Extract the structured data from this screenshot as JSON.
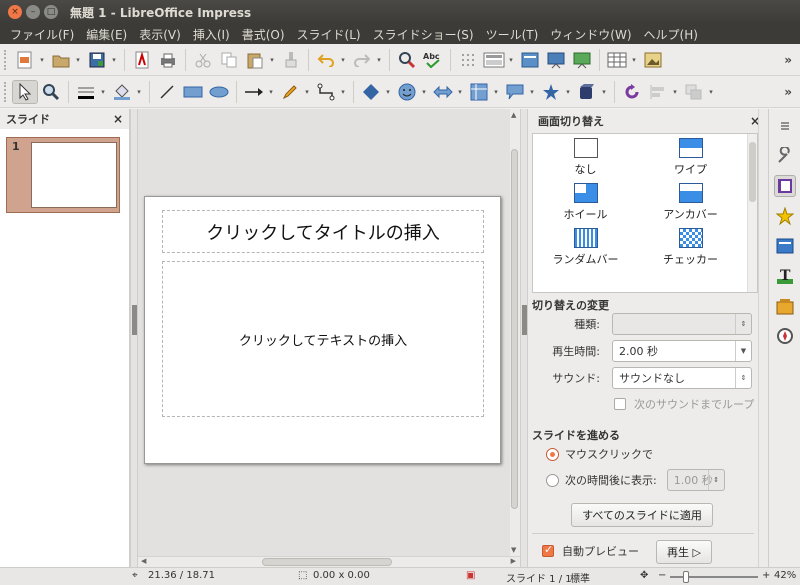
{
  "window": {
    "title": "無題 1 - LibreOffice Impress",
    "close": "×",
    "minimize": "–",
    "maximize": "□"
  },
  "menu": [
    "ファイル(F)",
    "編集(E)",
    "表示(V)",
    "挿入(I)",
    "書式(O)",
    "スライド(L)",
    "スライドショー(S)",
    "ツール(T)",
    "ウィンドウ(W)",
    "ヘルプ(H)"
  ],
  "toolbar": {
    "overflow": "»"
  },
  "slide_pane": {
    "title": "スライド",
    "close": "×",
    "slide_number": "1"
  },
  "slide": {
    "title_placeholder": "クリックしてタイトルの挿入",
    "text_placeholder": "クリックしてテキストの挿入"
  },
  "task_pane": {
    "title": "画面切り替え",
    "close": "×",
    "effects": [
      {
        "label": "なし",
        "icon": "none-transition-icon"
      },
      {
        "label": "ワイプ",
        "icon": "wipe-transition-icon"
      },
      {
        "label": "ホイール",
        "icon": "wheel-transition-icon"
      },
      {
        "label": "アンカバー",
        "icon": "uncover-transition-icon"
      },
      {
        "label": "ランダムバー",
        "icon": "random-bars-transition-icon"
      },
      {
        "label": "チェッカー",
        "icon": "checker-transition-icon"
      }
    ],
    "modify_section": "切り替えの変更",
    "variant_label": "種類:",
    "duration_label": "再生時間:",
    "duration_value": "2.00 秒",
    "sound_label": "サウンド:",
    "sound_value": "サウンドなし",
    "loop_label": "次のサウンドまでループ",
    "advance_section": "スライドを進める",
    "on_click_label": "マウスクリックで",
    "auto_label": "次の時間後に表示:",
    "auto_value": "1.00 秒",
    "apply_all": "すべてのスライドに適用",
    "autopreview_label": "自動プレビュー",
    "play_button": "再生 ▷"
  },
  "statusbar": {
    "position": "21.36 / 18.71",
    "size": "0.00 x 0.00",
    "slide": "スライド 1 / 1",
    "layout": "標準",
    "zoom": "42%"
  },
  "colors": {
    "accent": "#f07746",
    "titlebar": "#3c3b37",
    "thumb_border": "#cfa38d"
  }
}
